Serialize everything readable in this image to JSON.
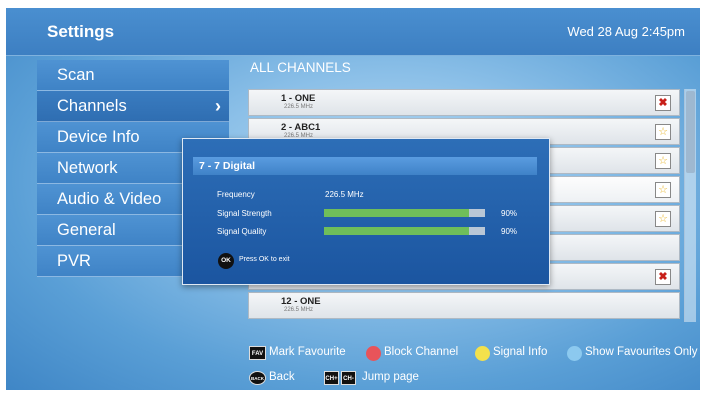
{
  "header": {
    "title": "Settings",
    "datetime": "Wed 28 Aug 2:45pm"
  },
  "sidebar": {
    "items": [
      {
        "label": "Scan"
      },
      {
        "label": "Channels",
        "chevron": "›"
      },
      {
        "label": "Device Info"
      },
      {
        "label": "Network"
      },
      {
        "label": "Audio & Video"
      },
      {
        "label": "General"
      },
      {
        "label": "PVR"
      }
    ]
  },
  "list": {
    "title": "ALL CHANNELS",
    "rows": [
      {
        "name": "1 - ONE",
        "freq": "226.5 MHz",
        "action": "block-icon"
      },
      {
        "name": "2 - ABC1",
        "freq": "226.5 MHz",
        "action": "star-icon"
      },
      {
        "name": "",
        "freq": "",
        "action": "star-icon"
      },
      {
        "name": "",
        "freq": "",
        "action": "star-icon"
      },
      {
        "name": "",
        "freq": "",
        "action": "star-icon"
      },
      {
        "name": "",
        "freq": "",
        "action": ""
      },
      {
        "name": "",
        "freq": "",
        "action": "block-icon"
      },
      {
        "name": "12 - ONE",
        "freq": "226.5 MHz",
        "action": ""
      }
    ]
  },
  "dialog": {
    "title": "7 - 7 Digital",
    "frequency_label": "Frequency",
    "frequency_value": "226.5 MHz",
    "strength_label": "Signal Strength",
    "strength_pct": "90%",
    "strength_level": 0.9,
    "quality_label": "Signal Quality",
    "quality_pct": "90%",
    "quality_level": 0.9,
    "ok_key": "OK",
    "ok_hint": "Press OK to exit"
  },
  "footer": {
    "fav_key": "FAV",
    "fav_label": "Mark Favourite",
    "block_label": "Block Channel",
    "signal_label": "Signal Info",
    "show_fav_label": "Show Favourites Only",
    "back_key": "BACK",
    "back_label": "Back",
    "chplus_key": "CH+",
    "chminus_key": "CH-",
    "jump_label": "Jump page"
  },
  "colors": {
    "red_key": "#e8545a",
    "yellow_key": "#f3e14c",
    "blue_key": "#8cc9ef",
    "bar_fill": "#6fbe5a"
  }
}
